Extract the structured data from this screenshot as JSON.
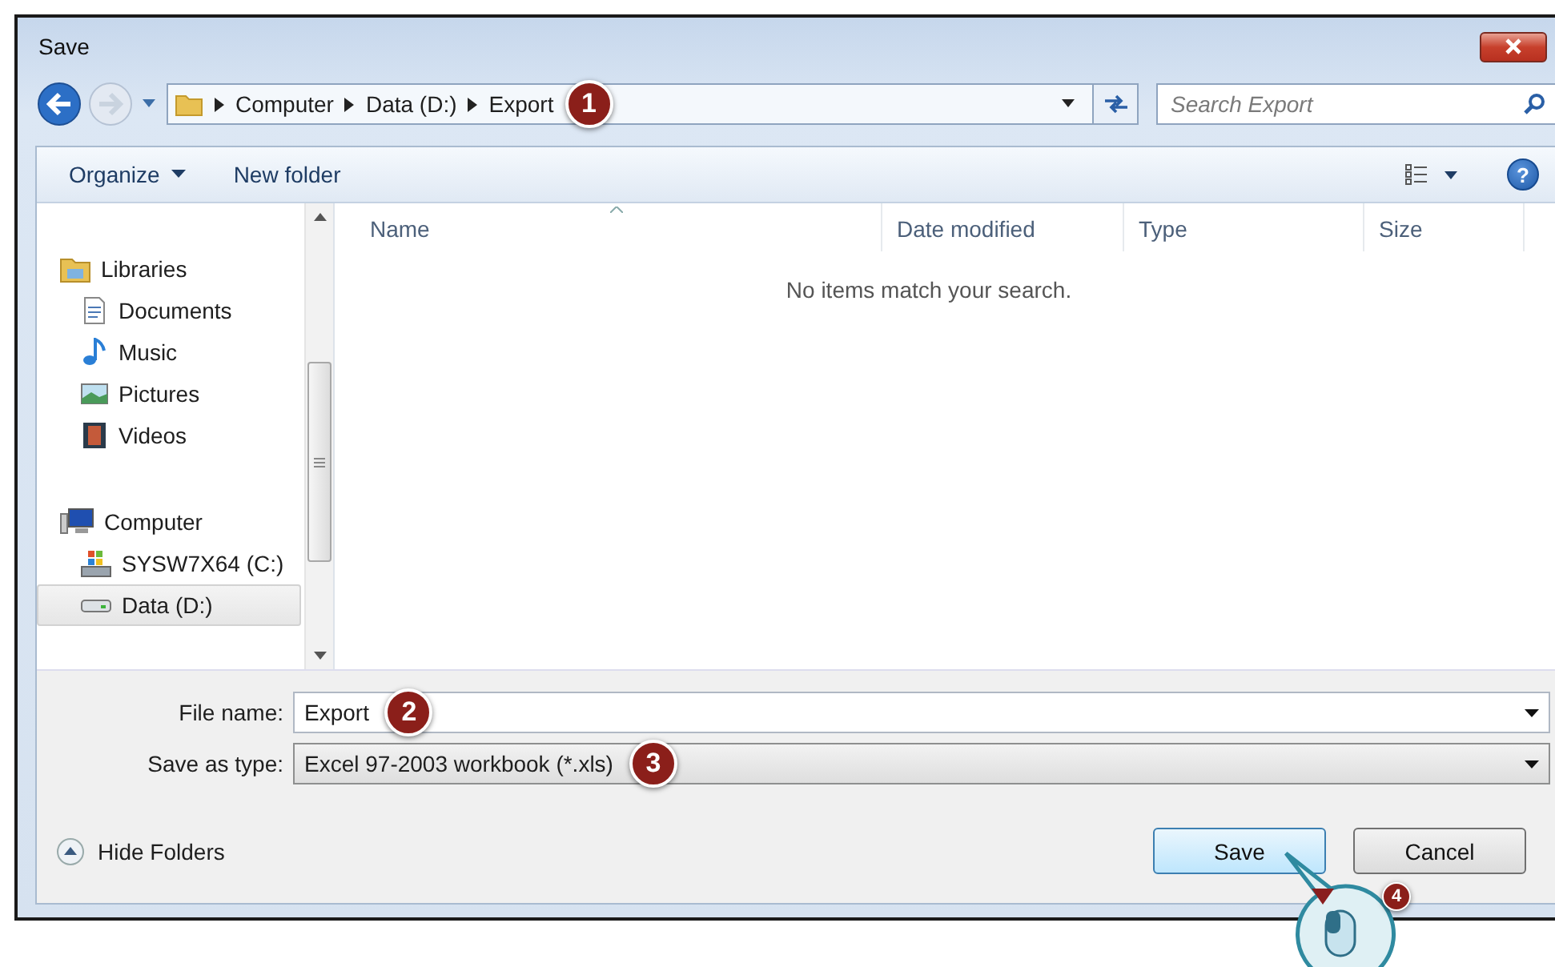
{
  "window": {
    "title": "Save"
  },
  "address_bar": {
    "path": [
      "Computer",
      "Data (D:)",
      "Export"
    ],
    "callout": "1"
  },
  "search": {
    "placeholder": "Search Export"
  },
  "toolbar": {
    "items": [
      {
        "label": "Organize",
        "kind": "menu"
      },
      {
        "label": "New folder",
        "kind": "plain"
      }
    ],
    "help": "?"
  },
  "nav": {
    "groups": [
      {
        "label": "Libraries",
        "kind": "library",
        "selected": false,
        "children": [
          {
            "label": "Documents",
            "kind": "document",
            "selected": false
          },
          {
            "label": "Music",
            "kind": "music",
            "selected": false
          },
          {
            "label": "Pictures",
            "kind": "picture",
            "selected": false
          },
          {
            "label": "Videos",
            "kind": "video",
            "selected": false
          }
        ]
      },
      {
        "label": "Computer",
        "kind": "computer",
        "selected": false,
        "children": [
          {
            "label": "SYSW7X64 (C:)",
            "kind": "system-drive",
            "selected": false
          },
          {
            "label": "Data (D:)",
            "kind": "drive",
            "selected": true
          }
        ]
      }
    ]
  },
  "columns": [
    "Name",
    "Date modified",
    "Type",
    "Size"
  ],
  "empty_message": "No items match your search.",
  "file_name": {
    "label": "File name:",
    "value": "Export",
    "callout": "2"
  },
  "save_as_type": {
    "label": "Save as type:",
    "value": "Excel 97-2003 workbook (*.xls)",
    "callout": "3"
  },
  "hide_folders": "Hide Folders",
  "buttons": [
    {
      "label": "Save",
      "kind": "primary",
      "callout": "4"
    },
    {
      "label": "Cancel",
      "kind": "normal"
    }
  ]
}
